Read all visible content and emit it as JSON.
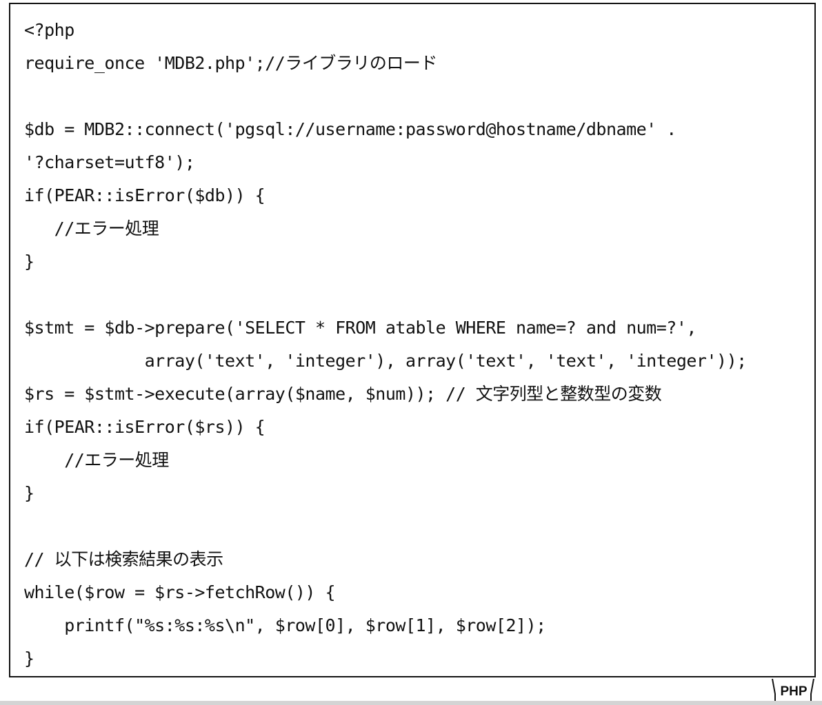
{
  "code": {
    "lines": [
      "<?php",
      "require_once 'MDB2.php';//ライブラリのロード",
      "",
      "$db = MDB2::connect('pgsql://username:password@hostname/dbname' .",
      "'?charset=utf8');",
      "if(PEAR::isError($db)) {",
      "   //エラー処理",
      "}",
      "",
      "$stmt = $db->prepare('SELECT * FROM atable WHERE name=? and num=?',",
      "            array('text', 'integer'), array('text', 'text', 'integer'));",
      "$rs = $stmt->execute(array($name, $num)); // 文字列型と整数型の変数",
      "if(PEAR::isError($rs)) {",
      "    //エラー処理",
      "}",
      "",
      "// 以下は検索結果の表示",
      "while($row = $rs->fetchRow()) {",
      "    printf(\"%s:%s:%s\\n\", $row[0], $row[1], $row[2]);",
      "}"
    ]
  },
  "language_tab": {
    "label": "PHP"
  }
}
